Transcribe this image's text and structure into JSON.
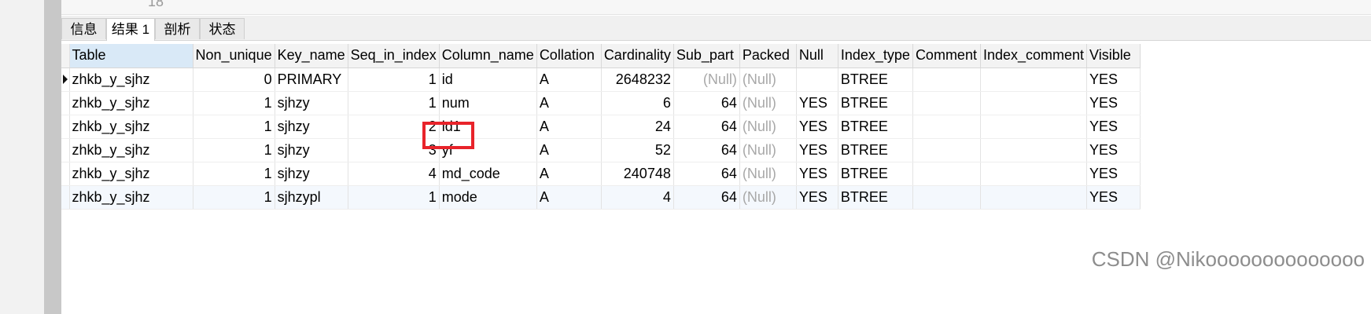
{
  "editor": {
    "line_number": "18"
  },
  "tabs": [
    {
      "label": "信息"
    },
    {
      "label": "结果 1"
    },
    {
      "label": "剖析"
    },
    {
      "label": "状态"
    }
  ],
  "grid": {
    "columns": [
      "Table",
      "Non_unique",
      "Key_name",
      "Seq_in_index",
      "Column_name",
      "Collation",
      "Cardinality",
      "Sub_part",
      "Packed",
      "Null",
      "Index_type",
      "Comment",
      "Index_comment",
      "Visible"
    ],
    "rows": [
      [
        "zhkb_y_sjhz",
        "0",
        "PRIMARY",
        "1",
        "id",
        "A",
        "2648232",
        "(Null)",
        "(Null)",
        "",
        "BTREE",
        "",
        "",
        "YES"
      ],
      [
        "zhkb_y_sjhz",
        "1",
        "sjhzy",
        "1",
        "num",
        "A",
        "6",
        "64",
        "(Null)",
        "YES",
        "BTREE",
        "",
        "",
        "YES"
      ],
      [
        "zhkb_y_sjhz",
        "1",
        "sjhzy",
        "2",
        "id1",
        "A",
        "24",
        "64",
        "(Null)",
        "YES",
        "BTREE",
        "",
        "",
        "YES"
      ],
      [
        "zhkb_y_sjhz",
        "1",
        "sjhzy",
        "3",
        "yf",
        "A",
        "52",
        "64",
        "(Null)",
        "YES",
        "BTREE",
        "",
        "",
        "YES"
      ],
      [
        "zhkb_y_sjhz",
        "1",
        "sjhzy",
        "4",
        "md_code",
        "A",
        "240748",
        "64",
        "(Null)",
        "YES",
        "BTREE",
        "",
        "",
        "YES"
      ],
      [
        "zhkb_y_sjhz",
        "1",
        "sjhzypl",
        "1",
        "mode",
        "A",
        "4",
        "64",
        "(Null)",
        "YES",
        "BTREE",
        "",
        "",
        "YES"
      ]
    ]
  },
  "watermark": "CSDN @Nikoooooooooooooo",
  "colors": {
    "highlight": "#e8232a",
    "selected_header": "#d9e9f7"
  }
}
